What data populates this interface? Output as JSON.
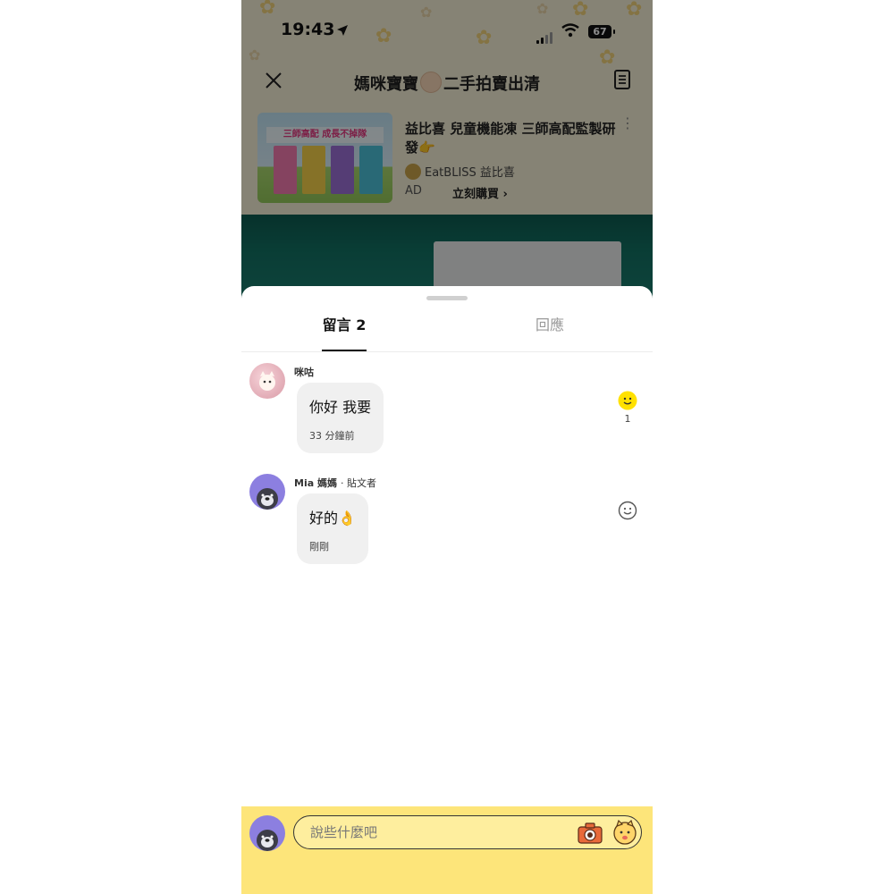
{
  "status_bar": {
    "time": "19:43",
    "battery": "67"
  },
  "group": {
    "title_prefix": "媽咪寶寶",
    "title_suffix": "二手拍賣出清"
  },
  "ad": {
    "image_banner": "三師高配 成長不掉隊",
    "title": "益比喜 兒童機能凍 三師高配監製研發👉",
    "brand": "EatBLISS 益比喜",
    "label": "AD",
    "cta": "立刻購買 ›"
  },
  "tabs": [
    {
      "label": "留言 2"
    },
    {
      "label": "回應"
    }
  ],
  "comments": [
    {
      "author": "咪咕",
      "role": "",
      "text": "你好 我要",
      "time": "33 分鐘前",
      "reaction_count": "1"
    },
    {
      "author": "Mia 媽媽",
      "role": "· 貼文者",
      "text": "好的👌",
      "time": "剛剛",
      "reaction_count": ""
    }
  ],
  "composer": {
    "placeholder": "說些什麼吧"
  },
  "colors": {
    "composer_bg": "#fde57a",
    "reaction_active": "#ffe100"
  },
  "icons": [
    "location-arrow-icon",
    "signal-icon",
    "wifi-icon",
    "battery-icon",
    "close-icon",
    "document-icon",
    "more-icon",
    "smiley-icon",
    "smiley-outline-icon",
    "camera-icon",
    "sticker-icon"
  ]
}
